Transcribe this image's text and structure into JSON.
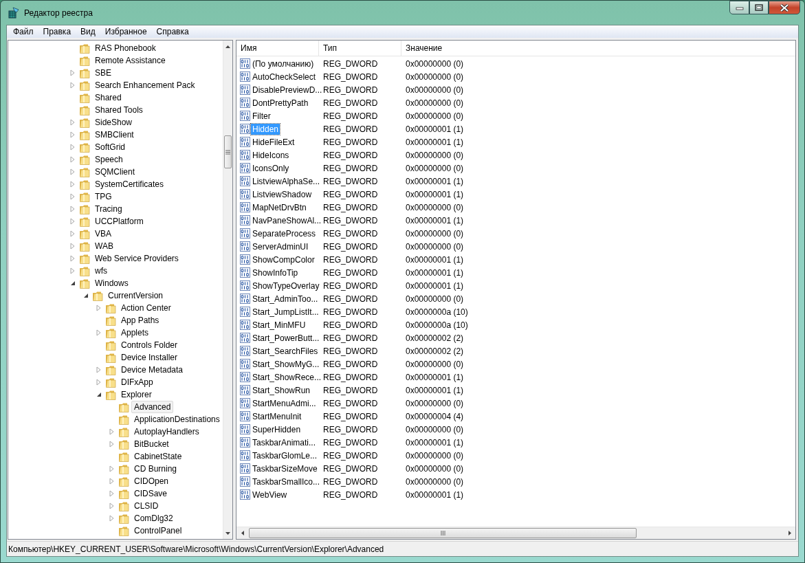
{
  "window": {
    "title": "Редактор реестра"
  },
  "menu": [
    "Файл",
    "Правка",
    "Вид",
    "Избранное",
    "Справка"
  ],
  "tree": {
    "items": [
      {
        "label": "RAS Phonebook",
        "kind": "leaf",
        "selected": false
      },
      {
        "label": "Remote Assistance",
        "kind": "leaf",
        "selected": false
      },
      {
        "label": "SBE",
        "kind": "closed",
        "selected": false
      },
      {
        "label": "Search Enhancement Pack",
        "kind": "closed",
        "selected": false
      },
      {
        "label": "Shared",
        "kind": "leaf",
        "selected": false
      },
      {
        "label": "Shared Tools",
        "kind": "leaf",
        "selected": false
      },
      {
        "label": "SideShow",
        "kind": "closed",
        "selected": false
      },
      {
        "label": "SMBClient",
        "kind": "closed",
        "selected": false
      },
      {
        "label": "SoftGrid",
        "kind": "closed",
        "selected": false
      },
      {
        "label": "Speech",
        "kind": "closed",
        "selected": false
      },
      {
        "label": "SQMClient",
        "kind": "closed",
        "selected": false
      },
      {
        "label": "SystemCertificates",
        "kind": "closed",
        "selected": false
      },
      {
        "label": "TPG",
        "kind": "closed",
        "selected": false
      },
      {
        "label": "Tracing",
        "kind": "closed",
        "selected": false
      },
      {
        "label": "UCCPlatform",
        "kind": "closed",
        "selected": false
      },
      {
        "label": "VBA",
        "kind": "closed",
        "selected": false
      },
      {
        "label": "WAB",
        "kind": "closed",
        "selected": false
      },
      {
        "label": "Web Service Providers",
        "kind": "closed",
        "selected": false
      },
      {
        "label": "wfs",
        "kind": "closed",
        "selected": false
      },
      {
        "label": "Windows",
        "kind": "open",
        "selected": false,
        "children": [
          {
            "label": "CurrentVersion",
            "kind": "open",
            "selected": false,
            "children": [
              {
                "label": "Action Center",
                "kind": "closed",
                "selected": false
              },
              {
                "label": "App Paths",
                "kind": "leaf",
                "selected": false
              },
              {
                "label": "Applets",
                "kind": "closed",
                "selected": false
              },
              {
                "label": "Controls Folder",
                "kind": "leaf",
                "selected": false
              },
              {
                "label": "Device Installer",
                "kind": "leaf",
                "selected": false
              },
              {
                "label": "Device Metadata",
                "kind": "closed",
                "selected": false
              },
              {
                "label": "DIFxApp",
                "kind": "closed",
                "selected": false
              },
              {
                "label": "Explorer",
                "kind": "open",
                "selected": false,
                "children": [
                  {
                    "label": "Advanced",
                    "kind": "leaf",
                    "selected": true
                  },
                  {
                    "label": "ApplicationDestinations",
                    "kind": "leaf",
                    "selected": false
                  },
                  {
                    "label": "AutoplayHandlers",
                    "kind": "closed",
                    "selected": false
                  },
                  {
                    "label": "BitBucket",
                    "kind": "closed",
                    "selected": false
                  },
                  {
                    "label": "CabinetState",
                    "kind": "leaf",
                    "selected": false
                  },
                  {
                    "label": "CD Burning",
                    "kind": "closed",
                    "selected": false
                  },
                  {
                    "label": "CIDOpen",
                    "kind": "closed",
                    "selected": false
                  },
                  {
                    "label": "CIDSave",
                    "kind": "closed",
                    "selected": false
                  },
                  {
                    "label": "CLSID",
                    "kind": "closed",
                    "selected": false
                  },
                  {
                    "label": "ComDlg32",
                    "kind": "closed",
                    "selected": false
                  },
                  {
                    "label": "ControlPanel",
                    "kind": "leaf",
                    "selected": false
                  }
                ]
              }
            ]
          }
        ]
      }
    ]
  },
  "values": {
    "columns": [
      "Имя",
      "Тип",
      "Значение"
    ],
    "rows": [
      {
        "name": "(По умолчанию)",
        "type": "REG_DWORD",
        "data": "0x00000000 (0)",
        "selected": false
      },
      {
        "name": "AutoCheckSelect",
        "type": "REG_DWORD",
        "data": "0x00000000 (0)",
        "selected": false
      },
      {
        "name": "DisablePreviewD...",
        "type": "REG_DWORD",
        "data": "0x00000000 (0)",
        "selected": false
      },
      {
        "name": "DontPrettyPath",
        "type": "REG_DWORD",
        "data": "0x00000000 (0)",
        "selected": false
      },
      {
        "name": "Filter",
        "type": "REG_DWORD",
        "data": "0x00000000 (0)",
        "selected": false
      },
      {
        "name": "Hidden",
        "type": "REG_DWORD",
        "data": "0x00000001 (1)",
        "selected": true
      },
      {
        "name": "HideFileExt",
        "type": "REG_DWORD",
        "data": "0x00000001 (1)",
        "selected": false
      },
      {
        "name": "HideIcons",
        "type": "REG_DWORD",
        "data": "0x00000000 (0)",
        "selected": false
      },
      {
        "name": "IconsOnly",
        "type": "REG_DWORD",
        "data": "0x00000000 (0)",
        "selected": false
      },
      {
        "name": "ListviewAlphaSe...",
        "type": "REG_DWORD",
        "data": "0x00000001 (1)",
        "selected": false
      },
      {
        "name": "ListviewShadow",
        "type": "REG_DWORD",
        "data": "0x00000001 (1)",
        "selected": false
      },
      {
        "name": "MapNetDrvBtn",
        "type": "REG_DWORD",
        "data": "0x00000000 (0)",
        "selected": false
      },
      {
        "name": "NavPaneShowAl...",
        "type": "REG_DWORD",
        "data": "0x00000001 (1)",
        "selected": false
      },
      {
        "name": "SeparateProcess",
        "type": "REG_DWORD",
        "data": "0x00000000 (0)",
        "selected": false
      },
      {
        "name": "ServerAdminUI",
        "type": "REG_DWORD",
        "data": "0x00000000 (0)",
        "selected": false
      },
      {
        "name": "ShowCompColor",
        "type": "REG_DWORD",
        "data": "0x00000001 (1)",
        "selected": false
      },
      {
        "name": "ShowInfoTip",
        "type": "REG_DWORD",
        "data": "0x00000001 (1)",
        "selected": false
      },
      {
        "name": "ShowTypeOverlay",
        "type": "REG_DWORD",
        "data": "0x00000001 (1)",
        "selected": false
      },
      {
        "name": "Start_AdminToo...",
        "type": "REG_DWORD",
        "data": "0x00000000 (0)",
        "selected": false
      },
      {
        "name": "Start_JumpListIt...",
        "type": "REG_DWORD",
        "data": "0x0000000a (10)",
        "selected": false
      },
      {
        "name": "Start_MinMFU",
        "type": "REG_DWORD",
        "data": "0x0000000a (10)",
        "selected": false
      },
      {
        "name": "Start_PowerButt...",
        "type": "REG_DWORD",
        "data": "0x00000002 (2)",
        "selected": false
      },
      {
        "name": "Start_SearchFiles",
        "type": "REG_DWORD",
        "data": "0x00000002 (2)",
        "selected": false
      },
      {
        "name": "Start_ShowMyG...",
        "type": "REG_DWORD",
        "data": "0x00000000 (0)",
        "selected": false
      },
      {
        "name": "Start_ShowRece...",
        "type": "REG_DWORD",
        "data": "0x00000001 (1)",
        "selected": false
      },
      {
        "name": "Start_ShowRun",
        "type": "REG_DWORD",
        "data": "0x00000001 (1)",
        "selected": false
      },
      {
        "name": "StartMenuAdmi...",
        "type": "REG_DWORD",
        "data": "0x00000000 (0)",
        "selected": false
      },
      {
        "name": "StartMenuInit",
        "type": "REG_DWORD",
        "data": "0x00000004 (4)",
        "selected": false
      },
      {
        "name": "SuperHidden",
        "type": "REG_DWORD",
        "data": "0x00000000 (0)",
        "selected": false
      },
      {
        "name": "TaskbarAnimati...",
        "type": "REG_DWORD",
        "data": "0x00000001 (1)",
        "selected": false
      },
      {
        "name": "TaskbarGlomLe...",
        "type": "REG_DWORD",
        "data": "0x00000000 (0)",
        "selected": false
      },
      {
        "name": "TaskbarSizeMove",
        "type": "REG_DWORD",
        "data": "0x00000000 (0)",
        "selected": false
      },
      {
        "name": "TaskbarSmallIco...",
        "type": "REG_DWORD",
        "data": "0x00000000 (0)",
        "selected": false
      },
      {
        "name": "WebView",
        "type": "REG_DWORD",
        "data": "0x00000001 (1)",
        "selected": false
      }
    ]
  },
  "status_bar": "Компьютер\\HKEY_CURRENT_USER\\Software\\Microsoft\\Windows\\CurrentVersion\\Explorer\\Advanced"
}
